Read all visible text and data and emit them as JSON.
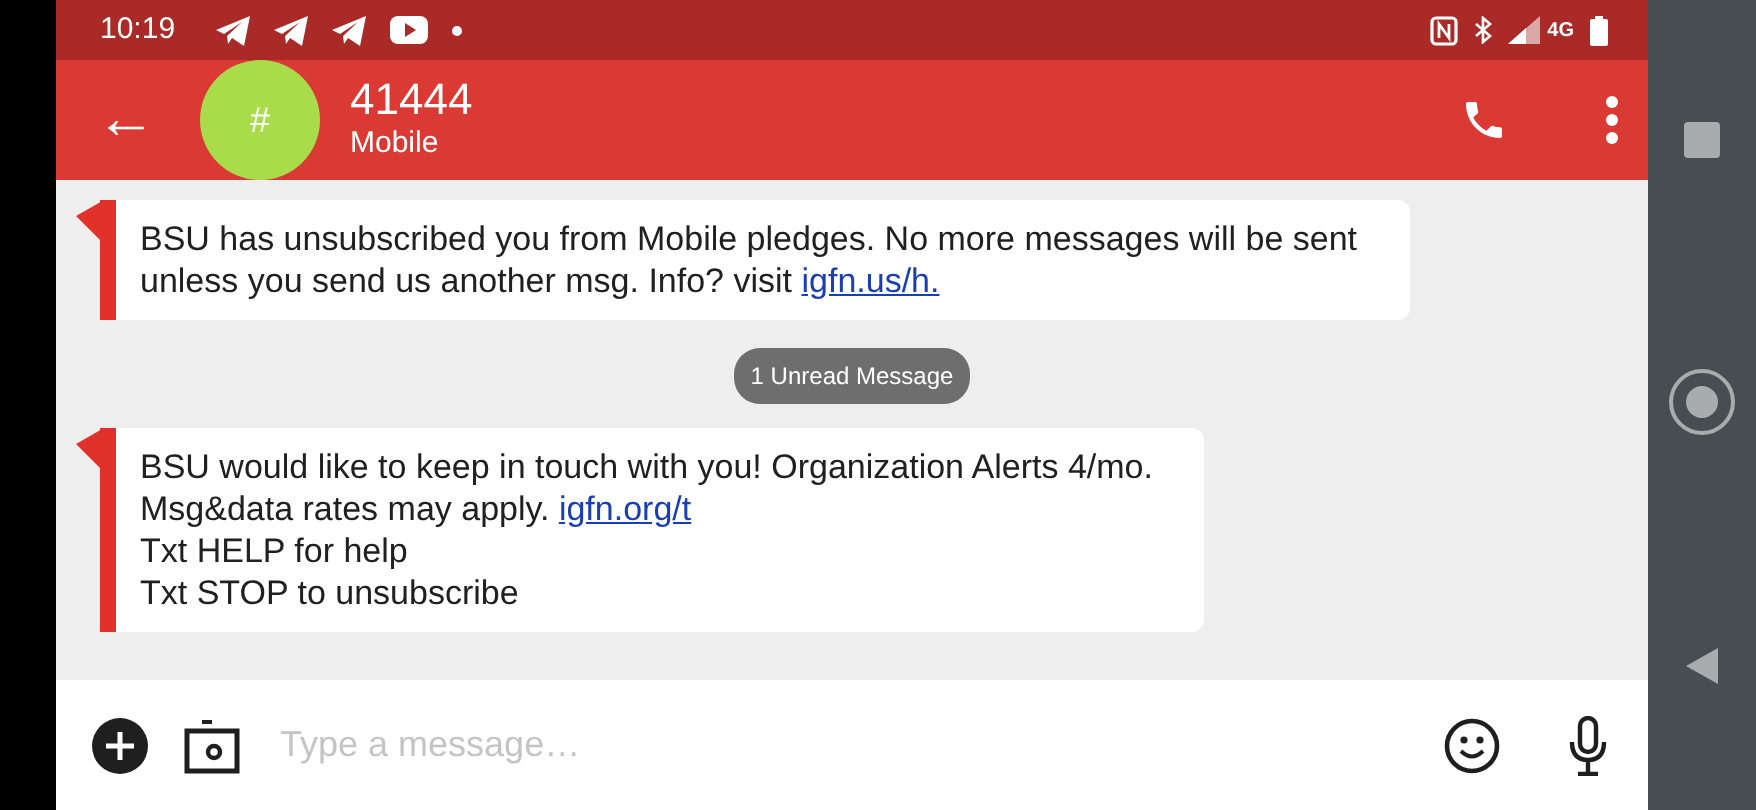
{
  "status_bar": {
    "time": "10:19",
    "network": "4G"
  },
  "header": {
    "back": "←",
    "avatar": "#",
    "title": "41444",
    "subtitle": "Mobile"
  },
  "messages": [
    {
      "kind": "message",
      "lines": [
        [
          {
            "kind": "text",
            "text": "BSU has unsubscribed you from Mobile pledges. No more messages will be sent"
          }
        ],
        [
          {
            "kind": "text",
            "text": "unless you send us another msg. Info? visit "
          },
          {
            "kind": "link",
            "text": "igfn.us/h."
          }
        ]
      ]
    },
    {
      "kind": "divider",
      "text": "1 Unread Message"
    },
    {
      "kind": "message",
      "lines": [
        [
          {
            "kind": "text",
            "text": "BSU would like to keep in touch with you! Organization Alerts 4/mo."
          }
        ],
        [
          {
            "kind": "text",
            "text": "Msg&data rates may apply. "
          },
          {
            "kind": "link",
            "text": "igfn.org/t"
          }
        ],
        [
          {
            "kind": "text",
            "text": "Txt HELP for help"
          }
        ],
        [
          {
            "kind": "text",
            "text": "Txt STOP to unsubscribe"
          }
        ]
      ]
    }
  ],
  "composer": {
    "placeholder": "Type a message…"
  }
}
